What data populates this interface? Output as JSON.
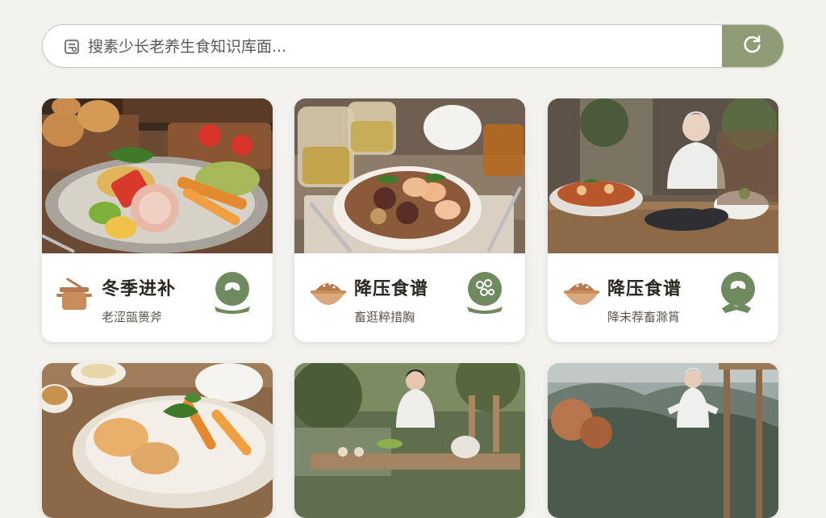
{
  "search": {
    "placeholder": "搜素少长老养生食知识库面...",
    "icon": "search-icon",
    "refresh_icon": "refresh-icon"
  },
  "colors": {
    "accent": "#8f9c76",
    "background": "#f3f2ee",
    "icon_brown": "#b77a4e",
    "icon_green": "#6f8a5f"
  },
  "cards": [
    {
      "title": "冬季进补",
      "subtitle": "老涩瓿篑斧",
      "category_icon": "pot-icon",
      "tag_icon": "leaf-badge-icon"
    },
    {
      "title": "降压食谱",
      "subtitle": "畜逛粹措胸",
      "category_icon": "bread-bowl-icon",
      "tag_icon": "herb-badge-icon"
    },
    {
      "title": "降压食谱",
      "subtitle": "降未荐畜滁筲",
      "category_icon": "bread-bowl-icon",
      "tag_icon": "exercise-badge-icon"
    }
  ]
}
